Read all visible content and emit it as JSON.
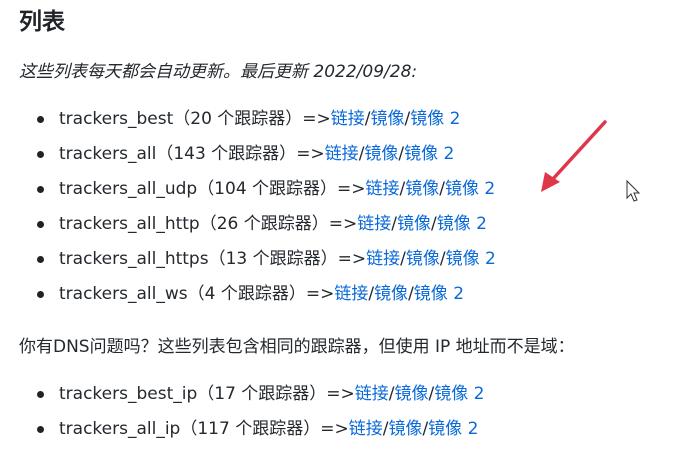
{
  "heading": "列表",
  "intro": "这些列表每天都会自动更新。最后更新 2022/09/28:",
  "list_main": [
    {
      "name": "trackers_best",
      "count": "（20 个跟踪器）",
      "arrow": "=>",
      "link": "链接",
      "mirror1": "镜像",
      "mirror2": "镜像 2"
    },
    {
      "name": "trackers_all",
      "count": "（143 个跟踪器）",
      "arrow": "=>",
      "link": "链接",
      "mirror1": "镜像",
      "mirror2": "镜像 2"
    },
    {
      "name": "trackers_all_udp",
      "count": "（104 个跟踪器）",
      "arrow": "=>",
      "link": "链接",
      "mirror1": "镜像",
      "mirror2": "镜像 2"
    },
    {
      "name": "trackers_all_http",
      "count": "（26 个跟踪器）",
      "arrow": "=>",
      "link": "链接",
      "mirror1": "镜像",
      "mirror2": "镜像 2"
    },
    {
      "name": "trackers_all_https",
      "count": "（13 个跟踪器）",
      "arrow": "=>",
      "link": "链接",
      "mirror1": "镜像",
      "mirror2": "镜像 2"
    },
    {
      "name": "trackers_all_ws",
      "count": "（4 个跟踪器）",
      "arrow": "=>",
      "link": "链接",
      "mirror1": "镜像",
      "mirror2": "镜像 2"
    }
  ],
  "dns_note": "你有DNS问题吗？这些列表包含相同的跟踪器，但使用 IP 地址而不是域：",
  "list_ip": [
    {
      "name": "trackers_best_ip",
      "count": "（17 个跟踪器）",
      "arrow": "=>",
      "link": "链接",
      "mirror1": "镜像",
      "mirror2": "镜像 2"
    },
    {
      "name": "trackers_all_ip",
      "count": "（117 个跟踪器）",
      "arrow": "=>",
      "link": "链接",
      "mirror1": "镜像",
      "mirror2": "镜像 2"
    }
  ],
  "separator": "/",
  "colors": {
    "link": "#0969da",
    "text": "#24292f",
    "annotation_arrow": "#e0364a"
  },
  "icons": {
    "annotation": "red-arrow-icon",
    "cursor": "mouse-pointer-icon"
  }
}
